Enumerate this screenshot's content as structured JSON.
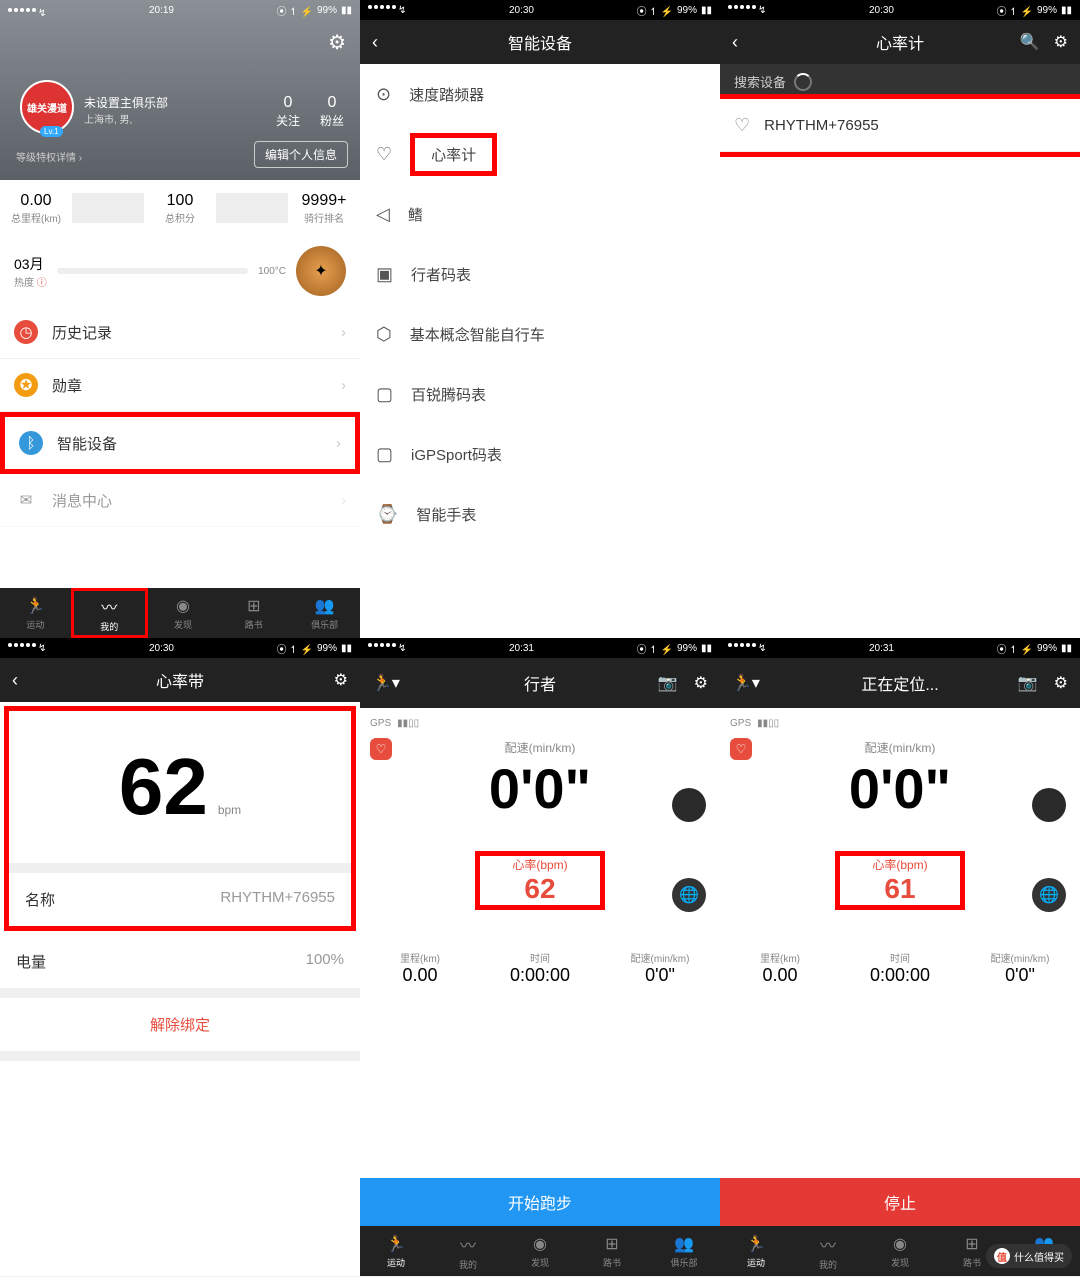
{
  "status": {
    "time1": "20:19",
    "time2": "20:30",
    "time3": "20:31",
    "battery": "99%"
  },
  "s1": {
    "club": "未设置主俱乐部",
    "loc": "上海市, 男,",
    "avatar": "雄关漫道",
    "lv": "Lv.1",
    "follow_n": "0",
    "follow_l": "关注",
    "fans_n": "0",
    "fans_l": "粉丝",
    "lvlink": "等级特权详情",
    "edit": "编辑个人信息",
    "km_v": "0.00",
    "km_l": "总里程(km)",
    "pts_v": "100",
    "pts_l": "总积分",
    "rank_v": "9999+",
    "rank_l": "骑行排名",
    "month": "03月",
    "heat_l": "热度",
    "temp": "100°C",
    "menu": {
      "history": "历史记录",
      "medal": "勋章",
      "smart": "智能设备",
      "msg": "消息中心"
    },
    "tabs": {
      "sport": "运动",
      "mine": "我的",
      "discover": "发现",
      "route": "路书",
      "club": "俱乐部"
    }
  },
  "s2": {
    "title": "智能设备",
    "items": {
      "cadence": "速度踏频器",
      "hr": "心率计",
      "fin": "鳍",
      "xz": "行者码表",
      "bike": "基本概念智能自行车",
      "brt": "百锐腾码表",
      "igps": "iGPSport码表",
      "watch": "智能手表"
    }
  },
  "s3": {
    "title": "心率计",
    "search": "搜索设备",
    "device": "RHYTHM+76955"
  },
  "s4": {
    "title": "心率带",
    "bpm": "62",
    "unit": "bpm",
    "name_l": "名称",
    "name_v": "RHYTHM+76955",
    "batt_l": "电量",
    "batt_v": "100%",
    "unbind": "解除绑定"
  },
  "s5": {
    "title": "行者",
    "gps": "GPS",
    "pace_l": "配速(min/km)",
    "pace_v": "0'0\"",
    "hr_l": "心率(bpm)",
    "hr_v": "62",
    "dist_l": "里程(km)",
    "dist_v": "0.00",
    "time_l": "时间",
    "time_v": "0:00:00",
    "sp_l": "配速(min/km)",
    "sp_v": "0'0\"",
    "btn": "开始跑步"
  },
  "s6": {
    "title": "正在定位...",
    "gps": "GPS",
    "pace_l": "配速(min/km)",
    "pace_v": "0'0\"",
    "hr_l": "心率(bpm)",
    "hr_v": "61",
    "dist_l": "里程(km)",
    "dist_v": "0.00",
    "time_l": "时间",
    "time_v": "0:00:00",
    "sp_l": "配速(min/km)",
    "sp_v": "0'0\"",
    "btn": "停止"
  },
  "watermark": "什么值得买"
}
